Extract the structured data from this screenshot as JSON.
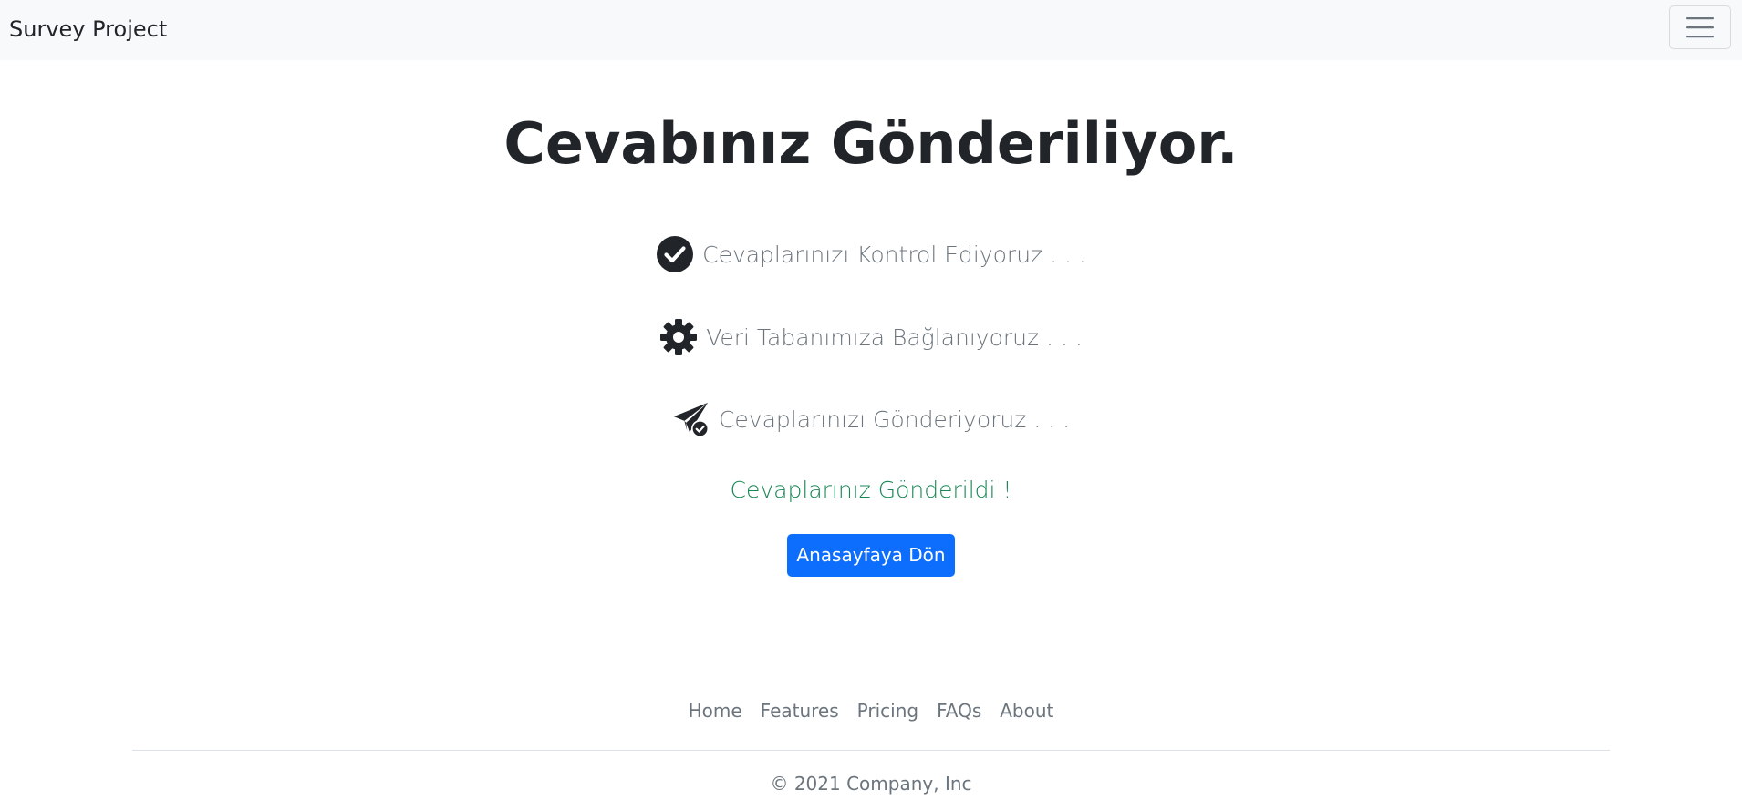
{
  "navbar": {
    "brand": "Survey Project",
    "toggler_icon": "hamburger-menu-icon"
  },
  "main": {
    "title": "Cevabınız Gönderiliyor.",
    "steps": [
      {
        "icon": "check-circle-icon",
        "label": "Cevaplarınızı Kontrol Ediyoruz . . ."
      },
      {
        "icon": "gear-icon",
        "label": "Veri Tabanımıza Bağlanıyoruz . . ."
      },
      {
        "icon": "paper-plane-check-icon",
        "label": "Cevaplarınızı Gönderiyoruz . . ."
      }
    ],
    "success_message": "Cevaplarınız Gönderildi !",
    "home_button_label": "Anasayfaya Dön"
  },
  "footer": {
    "links": [
      "Home",
      "Features",
      "Pricing",
      "FAQs",
      "About"
    ],
    "copyright": "© 2021 Company, Inc"
  },
  "colors": {
    "primary": "#0d6efd",
    "success": "#198754",
    "muted": "#6c757d",
    "dark": "#212529",
    "navbar_bg": "#f8f9fa"
  }
}
